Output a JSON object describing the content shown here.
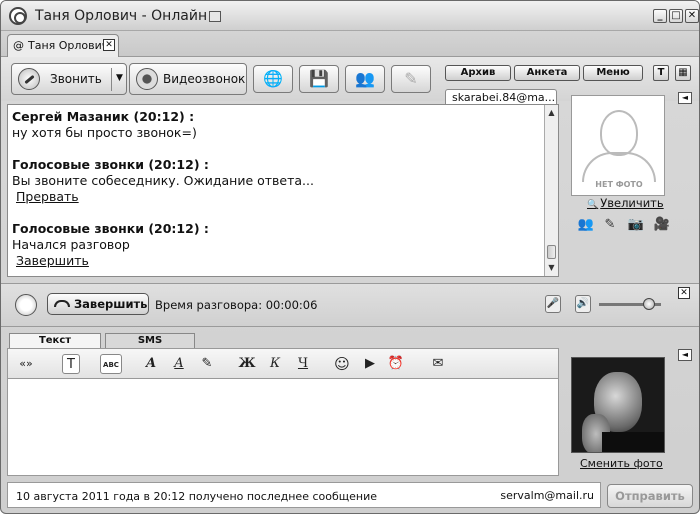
{
  "window": {
    "title": "Таня Орлович - Онлайн",
    "minimize": "_",
    "maximize": "□",
    "close": "✕"
  },
  "tab": {
    "label": "Таня Орлович",
    "close": "✕",
    "status_icon": "@"
  },
  "toolbar": {
    "call_label": "Звонить",
    "call_dropdown": "▼",
    "video_label": "Видеозвонок",
    "icons": [
      "globe-icon",
      "floppy-disk-icon",
      "contacts-icon",
      "edit-icon"
    ],
    "archive_label": "Архив",
    "profile_label": "Анкета",
    "menu_label": "Меню",
    "font_btn": "T",
    "grid_btn": "▦"
  },
  "account": {
    "tab_label": "skarabei.84@ma..."
  },
  "chat": {
    "messages": [
      {
        "header": "Сергей Мазаник (20:12) :",
        "text": "ну хотя бы просто звонок=)",
        "link": ""
      },
      {
        "header": "Голосовые звонки (20:12) :",
        "text": "Вы звоните собеседнику. Ожидание ответа...",
        "link": "Прервать"
      },
      {
        "header": "Голосовые звонки (20:12) :",
        "text": "Начался разговор",
        "link": "Завершить"
      }
    ]
  },
  "contact": {
    "no_photo": "НЕТ ФОТО",
    "zoom_link": "Увеличить",
    "collapse": "◄"
  },
  "call_panel": {
    "hangup_label": "Завершить",
    "call_time": "Время разговора: 00:00:06",
    "volume_level": 0.8,
    "close": "✕"
  },
  "compose": {
    "tabs": [
      "Текст",
      "SMS"
    ],
    "format_tools": [
      "«»",
      "T",
      "ABC",
      "A",
      "A",
      "✎",
      "Ж",
      "К",
      "Ч",
      "☺",
      "▶",
      "⏰",
      "✉"
    ],
    "collapse": "◄"
  },
  "own": {
    "change_photo": "Сменить фото"
  },
  "status": {
    "text": "10 августа 2011 года в 20:12 получено последнее сообщение",
    "email": "servalm@mail.ru",
    "send_label": "Отправить"
  }
}
